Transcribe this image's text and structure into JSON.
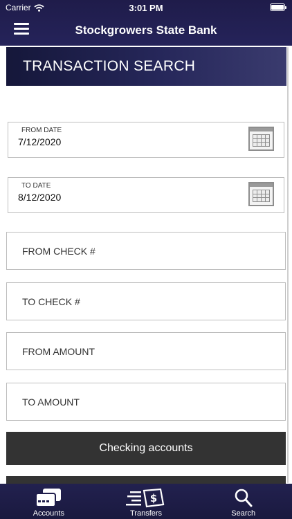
{
  "status_bar": {
    "carrier": "Carrier",
    "time": "3:01 PM"
  },
  "header": {
    "title": "Stockgrowers State Bank",
    "menu_icon": "hamburger-menu-icon"
  },
  "banner": {
    "title": "TRANSACTION SEARCH"
  },
  "from_date": {
    "label": "FROM DATE",
    "value": "7/12/2020",
    "icon": "calendar-icon"
  },
  "to_date": {
    "label": "TO DATE",
    "value": "8/12/2020",
    "icon": "calendar-icon"
  },
  "fields": {
    "from_check": "FROM CHECK #",
    "to_check": "TO CHECK #",
    "from_amount": "FROM AMOUNT",
    "to_amount": "TO AMOUNT"
  },
  "account_select": {
    "label": "Checking accounts"
  },
  "tabs": [
    {
      "label": "Accounts",
      "icon": "cards-icon"
    },
    {
      "label": "Transfers",
      "icon": "money-transfer-icon"
    },
    {
      "label": "Search",
      "icon": "search-icon"
    }
  ],
  "colors": {
    "header_bg": "#25235a",
    "banner_bg": "#26275a",
    "button_bg": "#333333",
    "tabbar_bg": "#1a193f"
  }
}
